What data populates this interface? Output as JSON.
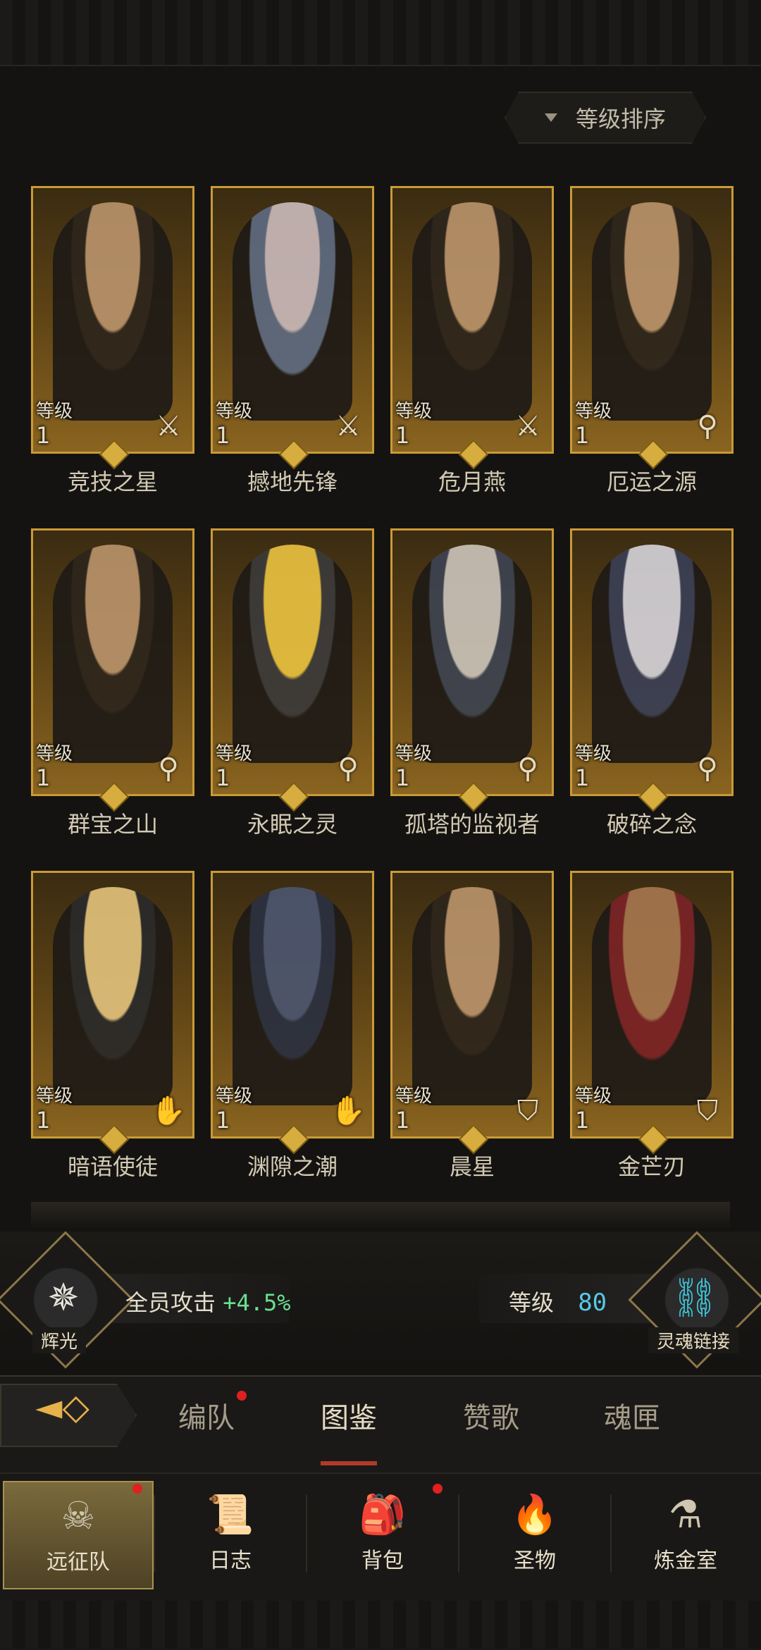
{
  "sort_button": {
    "label": "等级排序",
    "arrow_icon": "triangle-down-icon"
  },
  "heroes": [
    {
      "name": "竞技之星",
      "level_label": "等级",
      "level": "1",
      "class_icon": "sword-icon"
    },
    {
      "name": "撼地先锋",
      "level_label": "等级",
      "level": "1",
      "class_icon": "sword-icon"
    },
    {
      "name": "危月燕",
      "level_label": "等级",
      "level": "1",
      "class_icon": "sword-icon"
    },
    {
      "name": "厄运之源",
      "level_label": "等级",
      "level": "1",
      "class_icon": "staff-icon"
    },
    {
      "name": "群宝之山",
      "level_label": "等级",
      "level": "1",
      "class_icon": "staff-icon"
    },
    {
      "name": "永眠之灵",
      "level_label": "等级",
      "level": "1",
      "class_icon": "staff-icon"
    },
    {
      "name": "孤塔的监视者",
      "level_label": "等级",
      "level": "1",
      "class_icon": "staff-icon"
    },
    {
      "name": "破碎之念",
      "level_label": "等级",
      "level": "1",
      "class_icon": "staff-icon"
    },
    {
      "name": "暗语使徒",
      "level_label": "等级",
      "level": "1",
      "class_icon": "hand-icon"
    },
    {
      "name": "渊隙之潮",
      "level_label": "等级",
      "level": "1",
      "class_icon": "hand-icon"
    },
    {
      "name": "晨星",
      "level_label": "等级",
      "level": "1",
      "class_icon": "shield-icon"
    },
    {
      "name": "金芒刃",
      "level_label": "等级",
      "level": "1",
      "class_icon": "shield-icon"
    }
  ],
  "hero_bar": {
    "left_badge_label": "辉光",
    "left_badge_icon": "compass-star-icon",
    "stat_label": "全员攻击",
    "stat_value": "+4.5%",
    "level_label": "等级",
    "level_value": "80",
    "right_badge_label": "灵魂链接",
    "right_badge_icon": "chain-link-icon"
  },
  "tabs": {
    "back_icon": "back-arrow-icon",
    "items": [
      {
        "label": "编队",
        "badge": true
      },
      {
        "label": "图鉴",
        "active": true
      },
      {
        "label": "赞歌"
      },
      {
        "label": "魂匣"
      }
    ]
  },
  "nav": [
    {
      "label": "远征队",
      "icon": "horned-helmet-icon",
      "active": true,
      "badge": true
    },
    {
      "label": "日志",
      "icon": "scroll-icon"
    },
    {
      "label": "背包",
      "icon": "bag-icon",
      "badge": true
    },
    {
      "label": "圣物",
      "icon": "torch-icon"
    },
    {
      "label": "炼金室",
      "icon": "alchemy-icon"
    }
  ],
  "colors": {
    "accent_gold": "#c99a36",
    "stat_green": "#69e091",
    "level_blue": "#57c9e7",
    "badge_red": "#e02020"
  }
}
